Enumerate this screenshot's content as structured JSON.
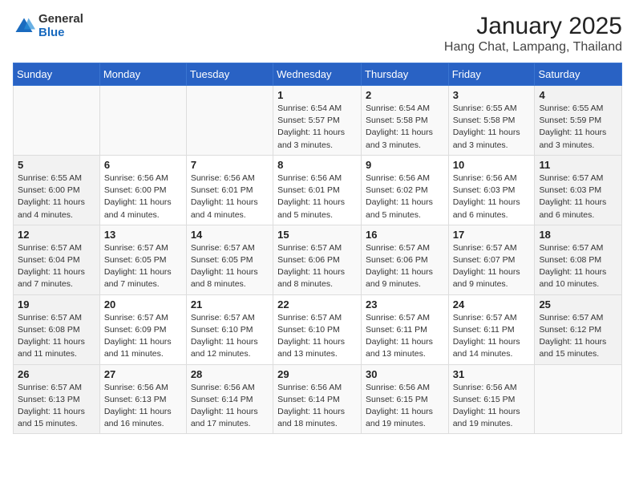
{
  "header": {
    "logo_general": "General",
    "logo_blue": "Blue",
    "title": "January 2025",
    "subtitle": "Hang Chat, Lampang, Thailand"
  },
  "weekdays": [
    "Sunday",
    "Monday",
    "Tuesday",
    "Wednesday",
    "Thursday",
    "Friday",
    "Saturday"
  ],
  "weeks": [
    [
      {
        "day": "",
        "info": ""
      },
      {
        "day": "",
        "info": ""
      },
      {
        "day": "",
        "info": ""
      },
      {
        "day": "1",
        "info": "Sunrise: 6:54 AM\nSunset: 5:57 PM\nDaylight: 11 hours and 3 minutes."
      },
      {
        "day": "2",
        "info": "Sunrise: 6:54 AM\nSunset: 5:58 PM\nDaylight: 11 hours and 3 minutes."
      },
      {
        "day": "3",
        "info": "Sunrise: 6:55 AM\nSunset: 5:58 PM\nDaylight: 11 hours and 3 minutes."
      },
      {
        "day": "4",
        "info": "Sunrise: 6:55 AM\nSunset: 5:59 PM\nDaylight: 11 hours and 3 minutes."
      }
    ],
    [
      {
        "day": "5",
        "info": "Sunrise: 6:55 AM\nSunset: 6:00 PM\nDaylight: 11 hours and 4 minutes."
      },
      {
        "day": "6",
        "info": "Sunrise: 6:56 AM\nSunset: 6:00 PM\nDaylight: 11 hours and 4 minutes."
      },
      {
        "day": "7",
        "info": "Sunrise: 6:56 AM\nSunset: 6:01 PM\nDaylight: 11 hours and 4 minutes."
      },
      {
        "day": "8",
        "info": "Sunrise: 6:56 AM\nSunset: 6:01 PM\nDaylight: 11 hours and 5 minutes."
      },
      {
        "day": "9",
        "info": "Sunrise: 6:56 AM\nSunset: 6:02 PM\nDaylight: 11 hours and 5 minutes."
      },
      {
        "day": "10",
        "info": "Sunrise: 6:56 AM\nSunset: 6:03 PM\nDaylight: 11 hours and 6 minutes."
      },
      {
        "day": "11",
        "info": "Sunrise: 6:57 AM\nSunset: 6:03 PM\nDaylight: 11 hours and 6 minutes."
      }
    ],
    [
      {
        "day": "12",
        "info": "Sunrise: 6:57 AM\nSunset: 6:04 PM\nDaylight: 11 hours and 7 minutes."
      },
      {
        "day": "13",
        "info": "Sunrise: 6:57 AM\nSunset: 6:05 PM\nDaylight: 11 hours and 7 minutes."
      },
      {
        "day": "14",
        "info": "Sunrise: 6:57 AM\nSunset: 6:05 PM\nDaylight: 11 hours and 8 minutes."
      },
      {
        "day": "15",
        "info": "Sunrise: 6:57 AM\nSunset: 6:06 PM\nDaylight: 11 hours and 8 minutes."
      },
      {
        "day": "16",
        "info": "Sunrise: 6:57 AM\nSunset: 6:06 PM\nDaylight: 11 hours and 9 minutes."
      },
      {
        "day": "17",
        "info": "Sunrise: 6:57 AM\nSunset: 6:07 PM\nDaylight: 11 hours and 9 minutes."
      },
      {
        "day": "18",
        "info": "Sunrise: 6:57 AM\nSunset: 6:08 PM\nDaylight: 11 hours and 10 minutes."
      }
    ],
    [
      {
        "day": "19",
        "info": "Sunrise: 6:57 AM\nSunset: 6:08 PM\nDaylight: 11 hours and 11 minutes."
      },
      {
        "day": "20",
        "info": "Sunrise: 6:57 AM\nSunset: 6:09 PM\nDaylight: 11 hours and 11 minutes."
      },
      {
        "day": "21",
        "info": "Sunrise: 6:57 AM\nSunset: 6:10 PM\nDaylight: 11 hours and 12 minutes."
      },
      {
        "day": "22",
        "info": "Sunrise: 6:57 AM\nSunset: 6:10 PM\nDaylight: 11 hours and 13 minutes."
      },
      {
        "day": "23",
        "info": "Sunrise: 6:57 AM\nSunset: 6:11 PM\nDaylight: 11 hours and 13 minutes."
      },
      {
        "day": "24",
        "info": "Sunrise: 6:57 AM\nSunset: 6:11 PM\nDaylight: 11 hours and 14 minutes."
      },
      {
        "day": "25",
        "info": "Sunrise: 6:57 AM\nSunset: 6:12 PM\nDaylight: 11 hours and 15 minutes."
      }
    ],
    [
      {
        "day": "26",
        "info": "Sunrise: 6:57 AM\nSunset: 6:13 PM\nDaylight: 11 hours and 15 minutes."
      },
      {
        "day": "27",
        "info": "Sunrise: 6:56 AM\nSunset: 6:13 PM\nDaylight: 11 hours and 16 minutes."
      },
      {
        "day": "28",
        "info": "Sunrise: 6:56 AM\nSunset: 6:14 PM\nDaylight: 11 hours and 17 minutes."
      },
      {
        "day": "29",
        "info": "Sunrise: 6:56 AM\nSunset: 6:14 PM\nDaylight: 11 hours and 18 minutes."
      },
      {
        "day": "30",
        "info": "Sunrise: 6:56 AM\nSunset: 6:15 PM\nDaylight: 11 hours and 19 minutes."
      },
      {
        "day": "31",
        "info": "Sunrise: 6:56 AM\nSunset: 6:15 PM\nDaylight: 11 hours and 19 minutes."
      },
      {
        "day": "",
        "info": ""
      }
    ]
  ]
}
